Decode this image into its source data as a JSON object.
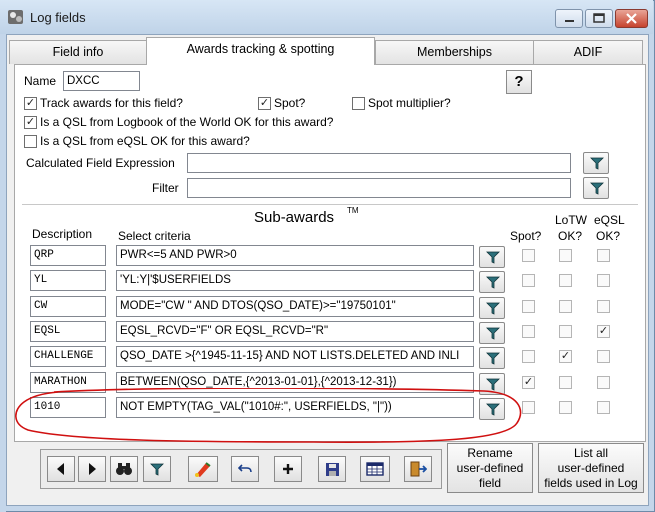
{
  "window": {
    "title": "Log fields"
  },
  "tabs": [
    {
      "label": "Field info"
    },
    {
      "label": "Awards tracking & spotting"
    },
    {
      "label": "Memberships"
    },
    {
      "label": "ADIF"
    }
  ],
  "form": {
    "name_label": "Name",
    "name_value": "DXCC",
    "help_label": "?",
    "track_awards_label": "Track awards for this field?",
    "track_awards_checked": true,
    "spot_label": "Spot?",
    "spot_checked": true,
    "spot_multiplier_label": "Spot multiplier?",
    "spot_multiplier_checked": false,
    "lotw_ok_label": "Is a  QSL from Logbook of the World OK for this award?",
    "lotw_ok_checked": true,
    "eqsl_ok_label": "Is a  QSL from eQSL OK for this award?",
    "eqsl_ok_checked": false,
    "calc_expr_label": "Calculated Field Expression",
    "calc_expr_value": "",
    "filter_label": "Filter",
    "filter_value": ""
  },
  "subawards": {
    "title": "Sub-awards",
    "tm": "TM",
    "headers": {
      "description": "Description",
      "criteria": "Select criteria",
      "spot": "Spot?",
      "lotw_line1": "LoTW",
      "lotw_line2": "OK?",
      "eqsl_line1": "eQSL",
      "eqsl_line2": "OK?"
    },
    "rows": [
      {
        "description": "QRP",
        "criteria": "PWR<=5 AND PWR>0",
        "spot": false,
        "lotw": false,
        "eqsl": false
      },
      {
        "description": "YL",
        "criteria": "'YL:Y|'$USERFIELDS",
        "spot": false,
        "lotw": false,
        "eqsl": false
      },
      {
        "description": "CW",
        "criteria": "MODE=\"CW \" AND DTOS(QSO_DATE)>=\"19750101\"",
        "spot": false,
        "lotw": false,
        "eqsl": false
      },
      {
        "description": "EQSL",
        "criteria": "EQSL_RCVD=\"F\" OR EQSL_RCVD=\"R\"",
        "spot": false,
        "lotw": false,
        "eqsl": true
      },
      {
        "description": "CHALLENGE",
        "criteria": "QSO_DATE >{^1945-11-15} AND NOT LISTS.DELETED AND INLI",
        "spot": false,
        "lotw": true,
        "eqsl": false
      },
      {
        "description": "MARATHON",
        "criteria": "BETWEEN(QSO_DATE,{^2013-01-01},{^2013-12-31})",
        "spot": true,
        "lotw": false,
        "eqsl": false
      },
      {
        "description": "1010",
        "criteria": "NOT EMPTY(TAG_VAL(\"1010#:\", USERFIELDS, \"|\"))",
        "spot": false,
        "lotw": false,
        "eqsl": false
      }
    ]
  },
  "buttons": {
    "rename_line1": "Rename",
    "rename_line2": "user-defined",
    "rename_line3": "field",
    "list_line1": "List all",
    "list_line2": "user-defined",
    "list_line3": "fields used in Log"
  },
  "toolbar_icons": [
    "prev-icon",
    "next-icon",
    "binoculars-icon",
    "filter-icon",
    "paint-icon",
    "undo-icon",
    "add-icon",
    "save-icon",
    "grid-icon",
    "exit-icon"
  ],
  "colors": {
    "annotation": "#d01010",
    "titlebar": "#c4d6ea",
    "close": "#c6432e"
  }
}
